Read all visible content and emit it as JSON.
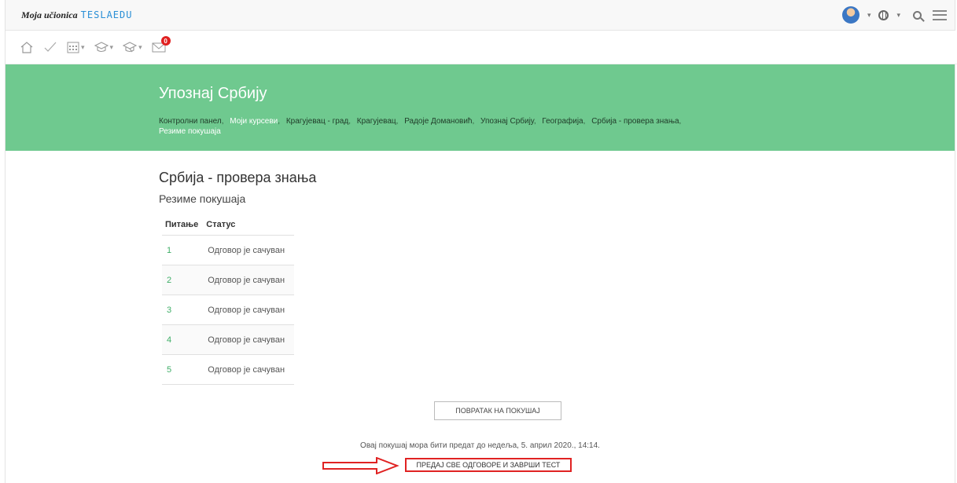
{
  "brand": {
    "script": "Moja učionica",
    "name": "TESLAEDU"
  },
  "colors": {
    "banner": "#6fc98f",
    "link": "#3fae67",
    "highlight": "#e02222"
  },
  "top_right": {
    "icons": [
      "avatar",
      "globe-icon",
      "search-icon",
      "menu-icon"
    ]
  },
  "toolbar": {
    "icons": [
      "home-icon",
      "check-icon",
      "calendar-icon",
      "course-icon",
      "courses-icon",
      "messages-icon"
    ],
    "message_count": "0"
  },
  "banner": {
    "title": "Упознај Србију",
    "breadcrumbs": [
      "Контролни панел",
      "Моји курсеви",
      "Крагујевац - град",
      "Крагујевац",
      "Радоје Домановић",
      "Упознај Србију",
      "Географија",
      "Србија - провера знања",
      "Резиме покушаја"
    ]
  },
  "main": {
    "heading": "Србија - провера знања",
    "subheading": "Резиме покушаја",
    "table": {
      "headers": [
        "Питање",
        "Статус"
      ],
      "rows": [
        {
          "q": "1",
          "status": "Одговор је сачуван"
        },
        {
          "q": "2",
          "status": "Одговор је сачуван"
        },
        {
          "q": "3",
          "status": "Одговор је сачуван"
        },
        {
          "q": "4",
          "status": "Одговор је сачуван"
        },
        {
          "q": "5",
          "status": "Одговор је сачуван"
        }
      ]
    },
    "return_button": "ПОВРАТАК НА ПОКУШАЈ",
    "deadline_text": "Овај покушај мора бити предат до недеља, 5. април 2020., 14:14.",
    "submit_button": "ПРЕДАЈ СВЕ ОДГОВОРЕ И ЗАВРШИ ТЕСТ"
  }
}
